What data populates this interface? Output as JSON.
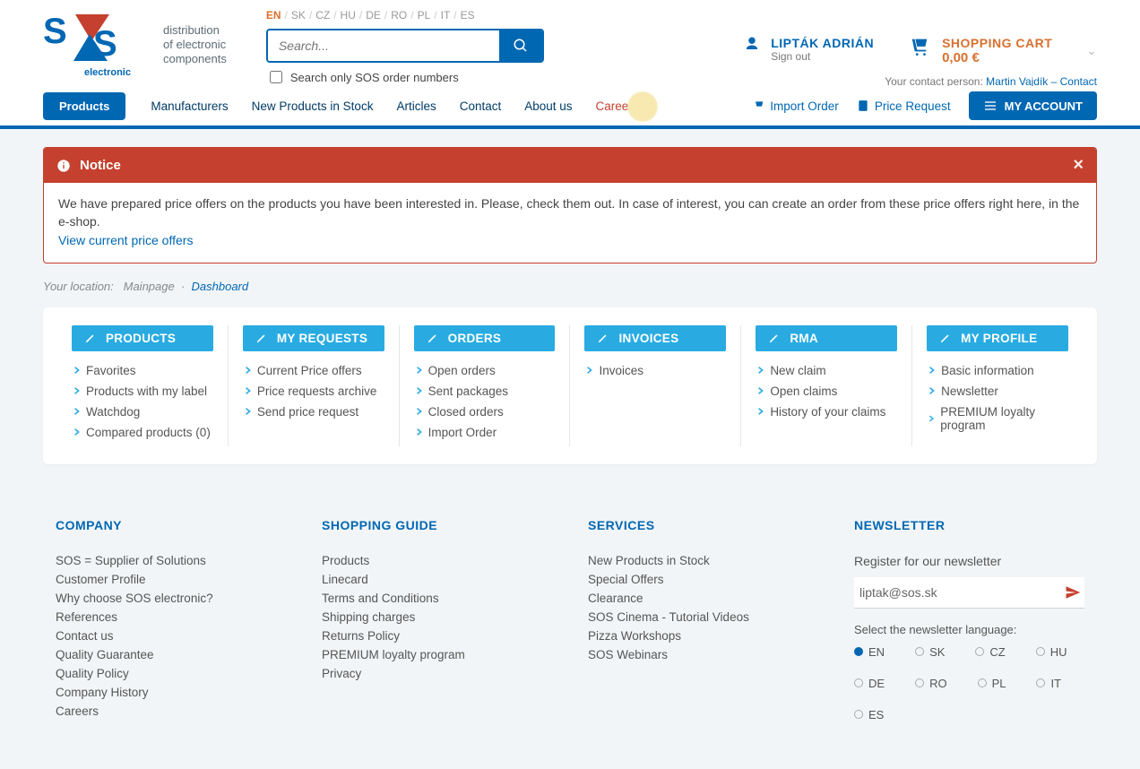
{
  "logo": {
    "tagline1": "distribution",
    "tagline2": "of electronic",
    "tagline3": "components",
    "brand": "electronic"
  },
  "languages": [
    "EN",
    "SK",
    "CZ",
    "HU",
    "DE",
    "RO",
    "PL",
    "IT",
    "ES"
  ],
  "activeLang": "EN",
  "search": {
    "placeholder": "Search...",
    "checkbox": "Search only SOS order numbers"
  },
  "account": {
    "name": "LIPTÁK ADRIÁN",
    "signout": "Sign out"
  },
  "contactLine": {
    "prefix": "Your contact person: ",
    "name": "Martin Vajdík – Contact"
  },
  "cart": {
    "title": "SHOPPING CART",
    "total": "0,00  €"
  },
  "nav": {
    "products": "Products",
    "links": [
      "Manufacturers",
      "New Products in Stock",
      "Articles",
      "Contact",
      "About us"
    ],
    "career": "Career",
    "import": "Import Order",
    "price_request": "Price Request",
    "myaccount": "MY ACCOUNT"
  },
  "notice": {
    "title": "Notice",
    "text": "We have prepared price offers on the products you have been interested in. Please, check them out. In case of interest, you can create an order from these price offers right here, in the e-shop.",
    "link": "View current price offers"
  },
  "breadcrumb": {
    "label": "Your location:",
    "main": "Mainpage",
    "current": "Dashboard"
  },
  "dashboard": [
    {
      "title": "PRODUCTS",
      "items": [
        "Favorites",
        "Products with my label",
        "Watchdog",
        "Compared products (0)"
      ]
    },
    {
      "title": "MY REQUESTS",
      "items": [
        "Current Price offers",
        "Price requests archive",
        "Send price request"
      ]
    },
    {
      "title": "ORDERS",
      "items": [
        "Open orders",
        "Sent packages",
        "Closed orders",
        "Import Order"
      ]
    },
    {
      "title": "INVOICES",
      "items": [
        "Invoices"
      ]
    },
    {
      "title": "RMA",
      "items": [
        "New claim",
        "Open claims",
        "History of your claims"
      ]
    },
    {
      "title": "MY PROFILE",
      "items": [
        "Basic information",
        "Newsletter",
        "PREMIUM loyalty program"
      ]
    }
  ],
  "footer": {
    "company": {
      "title": "COMPANY",
      "items": [
        "SOS = Supplier of Solutions",
        "Customer Profile",
        "Why choose SOS electronic?",
        "References",
        "Contact us",
        "Quality Guarantee",
        "Quality Policy",
        "Company History",
        "Careers"
      ]
    },
    "guide": {
      "title": "SHOPPING GUIDE",
      "items": [
        "Products",
        "Linecard",
        "Terms and Conditions",
        "Shipping charges",
        "Returns Policy",
        "PREMIUM loyalty program",
        "Privacy"
      ]
    },
    "services": {
      "title": "SERVICES",
      "items": [
        "New Products in Stock",
        "Special Offers",
        "Clearance",
        "SOS Cinema - Tutorial Videos",
        "Pizza Workshops",
        "SOS Webinars"
      ]
    },
    "newsletter": {
      "title": "NEWSLETTER",
      "register": "Register for our newsletter",
      "email": "liptak@sos.sk",
      "select_lang": "Select the newsletter language:",
      "langs": [
        "EN",
        "SK",
        "CZ",
        "HU",
        "DE",
        "RO",
        "PL",
        "IT",
        "ES"
      ],
      "active": "EN"
    }
  }
}
